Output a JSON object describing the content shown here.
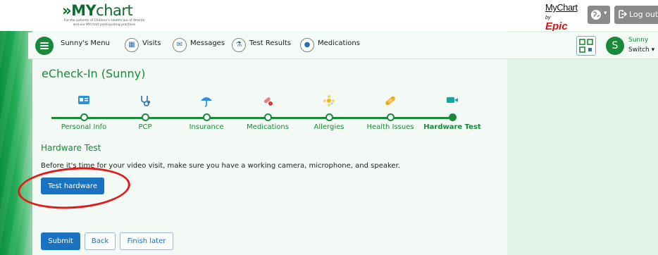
{
  "header": {
    "logo_prefix": "»MY",
    "logo_suffix": "chart",
    "logo_tagline": "For the patients of Children's Healthcare of Atlanta and our MYchart participating practices",
    "brand_word": "MyChart",
    "brand_by": "by",
    "brand_epic": "Epic",
    "globe_caret": "▾",
    "logout_label": "Log out"
  },
  "nav": {
    "menu_label": "Sunny's Menu",
    "items": [
      {
        "label": "Visits",
        "icon": "calendar-icon"
      },
      {
        "label": "Messages",
        "icon": "envelope-icon"
      },
      {
        "label": "Test Results",
        "icon": "flask-icon"
      },
      {
        "label": "Medications",
        "icon": "pills-icon"
      }
    ],
    "user_name": "Sunny",
    "user_initial": "S",
    "switch_label": "Switch ▾"
  },
  "page": {
    "title": "eCheck-In (Sunny)",
    "steps": [
      {
        "label": "Personal Info",
        "icon": "id-card-icon"
      },
      {
        "label": "PCP",
        "icon": "stethoscope-icon"
      },
      {
        "label": "Insurance",
        "icon": "umbrella-icon"
      },
      {
        "label": "Medications",
        "icon": "pills-icon"
      },
      {
        "label": "Allergies",
        "icon": "pollen-icon"
      },
      {
        "label": "Health Issues",
        "icon": "bandage-icon"
      },
      {
        "label": "Hardware Test",
        "icon": "video-camera-icon"
      }
    ],
    "current_step": "Hardware Test",
    "section_title": "Hardware Test",
    "description": "Before it's time for your video visit, make sure you have a working camera, microphone, and speaker.",
    "test_button": "Test hardware",
    "submit_button": "Submit",
    "back_button": "Back",
    "finish_later_button": "Finish later"
  },
  "colors": {
    "brand_green": "#198a3a",
    "primary_blue": "#1a73c1",
    "callout_red": "#e01b1b"
  }
}
